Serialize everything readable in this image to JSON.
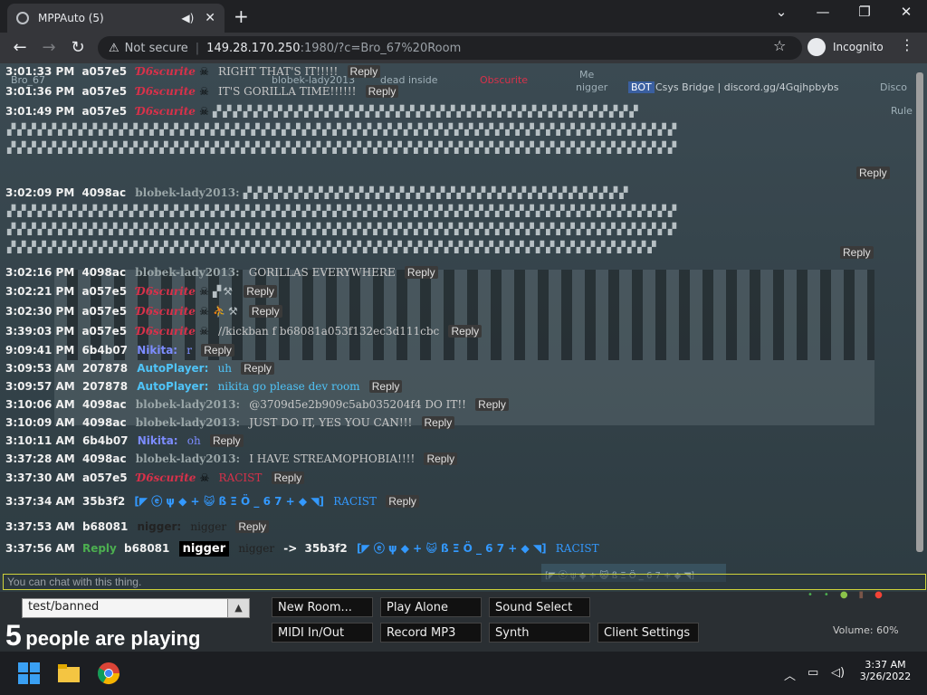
{
  "browser": {
    "tab_title": "MPPAuto (5)",
    "not_secure": "Not secure",
    "url_host": "149.28.170.250",
    "url_rest": ":1980/?c=Bro_67%20Room",
    "incognito": "Incognito"
  },
  "topbar": {
    "user_a": "Bro_67",
    "user_b": "blobek-lady2013",
    "user_b_sub": "dead inside",
    "obscurite": "Obscurite",
    "me": "Me",
    "nigger": "nigger",
    "bot": "BOT",
    "bridge": "Csys Bridge | discord.gg/4Gqjhpbybs",
    "disco": "Disco",
    "rules": "Rule"
  },
  "chat": {
    "reply_label": "Reply",
    "rows": [
      {
        "time": "3:01:33 PM",
        "id": "a057e5",
        "name": "Ɗ6scurite",
        "msg": "RIGHT THAT'S IT!!!!!"
      },
      {
        "time": "3:01:36 PM",
        "id": "a057e5",
        "name": "Ɗ6scurite",
        "msg": "IT'S GORILLA TIME!!!!!!"
      },
      {
        "time": "3:01:49 PM",
        "id": "a057e5",
        "name": "Ɗ6scurite",
        "msg": ""
      },
      {
        "time": "3:02:09 PM",
        "id": "4098ac",
        "name": "blobek-lady2013:",
        "msg": ""
      },
      {
        "time": "3:02:16 PM",
        "id": "4098ac",
        "name": "blobek-lady2013:",
        "msg": "GORILLAS EVERYWHERE"
      },
      {
        "time": "3:02:21 PM",
        "id": "a057e5",
        "name": "Ɗ6scurite",
        "msg": ""
      },
      {
        "time": "3:02:30 PM",
        "id": "a057e5",
        "name": "Ɗ6scurite",
        "msg": ""
      },
      {
        "time": "3:39:03 PM",
        "id": "a057e5",
        "name": "Ɗ6scurite",
        "msg": "//kickban f b68081a053f132ec3d111cbc"
      },
      {
        "time": "9:09:41 PM",
        "id": "6b4b07",
        "name": "Nikita:",
        "msg": "r"
      },
      {
        "time": "3:09:53 AM",
        "id": "207878",
        "name": "AutoPlayer:",
        "msg": "uh"
      },
      {
        "time": "3:09:57 AM",
        "id": "207878",
        "name": "AutoPlayer:",
        "msg": "nikita go please dev room"
      },
      {
        "time": "3:10:06 AM",
        "id": "4098ac",
        "name": "blobek-lady2013:",
        "msg": "@3709d5e2b909c5ab035204f4 DO IT!!"
      },
      {
        "time": "3:10:09 AM",
        "id": "4098ac",
        "name": "blobek-lady2013:",
        "msg": "JUST DO IT, YES YOU CAN!!!"
      },
      {
        "time": "3:10:11 AM",
        "id": "6b4b07",
        "name": "Nikita:",
        "msg": "oh"
      },
      {
        "time": "3:37:28 AM",
        "id": "4098ac",
        "name": "blobek-lady2013:",
        "msg": "I HAVE STREAMOPHOBIA!!!!"
      },
      {
        "time": "3:37:30 AM",
        "id": "a057e5",
        "name": "Ɗ6scurite",
        "msg": "RACIST"
      },
      {
        "time": "3:37:34 AM",
        "id": "35b3f2",
        "name": "[◤ ⓔ ψ ◆ + 😺 ß Ξ Ö _ 6 7 + ◆ ◥]",
        "msg": "RACIST"
      },
      {
        "time": "3:37:53 AM",
        "id": "b68081",
        "name": "nigger:",
        "msg": "nigger"
      },
      {
        "time": "3:37:56 AM",
        "reply_tag": "Reply",
        "id": "b68081",
        "name": "nigger",
        "msg": "nigger",
        "arrow": "->",
        "target_id": "35b3f2",
        "target_name": "[◤ ⓔ ψ ◆ + 😺 ß Ξ Ö _ 6 7 + ◆ ◥]",
        "target_msg": "RACIST"
      }
    ],
    "input_placeholder": "You can chat with this thing."
  },
  "bottom": {
    "room": "test/banned",
    "player_count": "5",
    "players_text": "people are playing",
    "buttons": {
      "new_room": "New Room...",
      "play_alone": "Play Alone",
      "sound_select": "Sound Select",
      "midi": "MIDI In/Out",
      "record": "Record MP3",
      "synth": "Synth",
      "client_settings": "Client Settings"
    },
    "volume": "Volume: 60%"
  },
  "taskbar": {
    "time": "3:37 AM",
    "date": "3/26/2022"
  },
  "colors": {
    "obscurite": "#d8314a",
    "autoplayer": "#4fc3f7",
    "nikita": "#7c8cff",
    "reply_green": "#4caf50"
  }
}
